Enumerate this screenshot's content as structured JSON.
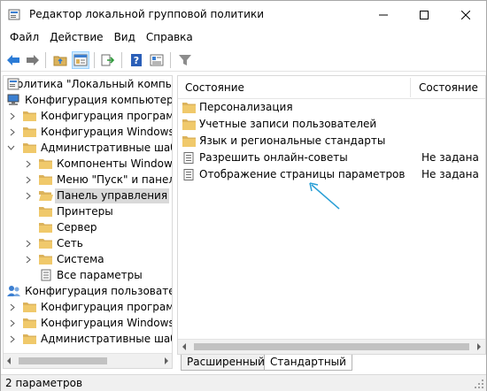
{
  "window": {
    "title": "Редактор локальной групповой политики"
  },
  "menu": [
    "Файл",
    "Действие",
    "Вид",
    "Справка"
  ],
  "tree": {
    "items": [
      {
        "label": "Политика \"Локальный компьютер\"",
        "expander": "none",
        "icon": "policy-icon"
      },
      {
        "label": "Конфигурация компьютера",
        "expander": "none",
        "icon": "computer-icon"
      },
      {
        "label": "Конфигурация программ",
        "expander": "collapsed",
        "icon": "folder-icon"
      },
      {
        "label": "Конфигурация Windows",
        "expander": "collapsed",
        "icon": "folder-icon"
      },
      {
        "label": "Административные шаблоны",
        "expander": "expanded",
        "icon": "folder-icon"
      },
      {
        "label": "Компоненты Windows",
        "expander": "collapsed",
        "icon": "folder-icon"
      },
      {
        "label": "Меню \"Пуск\" и панель задач",
        "expander": "collapsed",
        "icon": "folder-icon"
      },
      {
        "label": "Панель управления",
        "expander": "collapsed",
        "icon": "folder-open-icon",
        "selected": true
      },
      {
        "label": "Принтеры",
        "expander": "none",
        "icon": "folder-icon"
      },
      {
        "label": "Сервер",
        "expander": "none",
        "icon": "folder-icon"
      },
      {
        "label": "Сеть",
        "expander": "collapsed",
        "icon": "folder-icon"
      },
      {
        "label": "Система",
        "expander": "collapsed",
        "icon": "folder-icon"
      },
      {
        "label": "Все параметры",
        "expander": "none",
        "icon": "settings-page-icon"
      },
      {
        "label": "Конфигурация пользователя",
        "expander": "none",
        "icon": "user-icon"
      },
      {
        "label": "Конфигурация программ",
        "expander": "collapsed",
        "icon": "folder-icon"
      },
      {
        "label": "Конфигурация Windows",
        "expander": "collapsed",
        "icon": "folder-icon"
      },
      {
        "label": "Административные шаблоны",
        "expander": "collapsed",
        "icon": "folder-icon"
      }
    ]
  },
  "list": {
    "columns": [
      "Состояние",
      "Состояние"
    ],
    "rows": [
      {
        "name": "Персонализация",
        "state": "",
        "icon": "folder-icon"
      },
      {
        "name": "Учетные записи пользователей",
        "state": "",
        "icon": "folder-icon"
      },
      {
        "name": "Язык и региональные стандарты",
        "state": "",
        "icon": "folder-icon"
      },
      {
        "name": "Разрешить онлайн-советы",
        "state": "Не задана",
        "icon": "setting-icon"
      },
      {
        "name": "Отображение страницы параметров",
        "state": "Не задана",
        "icon": "setting-icon"
      }
    ]
  },
  "tabs": [
    "Расширенный",
    "Стандартный"
  ],
  "status": {
    "text": "2 параметров"
  },
  "colors": {
    "folder": "#dcb35c",
    "selection": "#d9d9d9",
    "annotation_arrow": "#2a9fd6"
  }
}
